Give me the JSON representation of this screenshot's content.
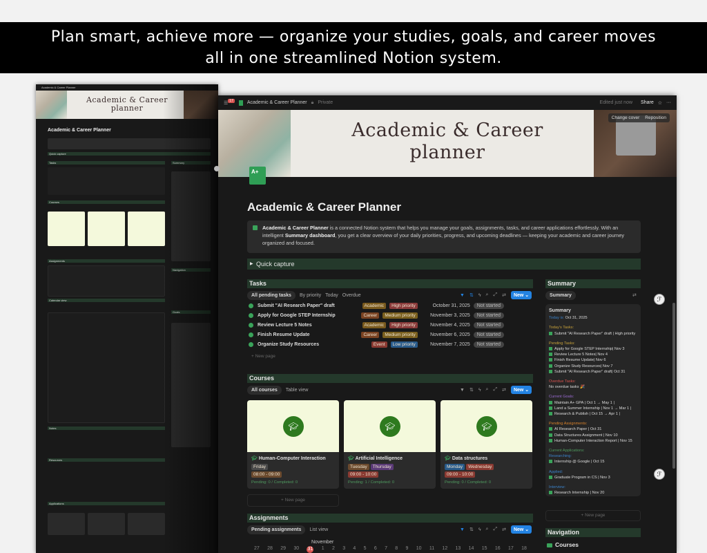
{
  "banner": {
    "line1": "Plan smart, achieve more — organize your studies, goals, and career moves",
    "line2": "all in one streamlined Notion system."
  },
  "topbar": {
    "badge": "17",
    "breadcrumb": "Academic & Career Planner",
    "privacy": "Private",
    "edited": "Edited just now",
    "share": "Share"
  },
  "cover": {
    "title_line1": "Academic & Career",
    "title_line2": "planner",
    "change_cover": "Change cover",
    "reposition": "Reposition"
  },
  "page": {
    "icon_text": "A+",
    "title": "Academic & Career Planner",
    "callout": {
      "bold1": "Academic & Career Planner",
      "text1": " is a connected Notion system that helps you manage your goals, assignments, tasks, and career applications effortlessly. With an intelligent ",
      "bold2": "Summary dashboard",
      "text2": ", you get a clear overview of your daily priorities, progress, and upcoming deadlines — keeping your academic and career journey organized and focused."
    },
    "quick_capture": "Quick capture"
  },
  "tasks": {
    "title": "Tasks",
    "views": [
      "All pending tasks",
      "By priority",
      "Today",
      "Overdue"
    ],
    "new": "New",
    "new_page": "New page",
    "rows": [
      {
        "name": "Submit \"AI Research Paper\" draft",
        "category": "Academic",
        "priority": "High priority",
        "date": "October 31, 2025",
        "status": "Not started"
      },
      {
        "name": "Apply for Google STEP Internship",
        "category": "Career",
        "priority": "Medium priority",
        "date": "November 3, 2025",
        "status": "Not started"
      },
      {
        "name": "Review Lecture 5 Notes",
        "category": "Academic",
        "priority": "High priority",
        "date": "November 4, 2025",
        "status": "Not started"
      },
      {
        "name": "Finish Resume Update",
        "category": "Career",
        "priority": "Medium priority",
        "date": "November 6, 2025",
        "status": "Not started"
      },
      {
        "name": "Organize Study Resources",
        "category": "Event",
        "priority": "Low priority",
        "date": "November 7, 2025",
        "status": "Not started"
      }
    ]
  },
  "colors": {
    "Academic": "#7a5a1e",
    "Career": "#7a4322",
    "Event": "#8a3a32",
    "High priority": "#8a3a3a",
    "Medium priority": "#7a5f1e",
    "Low priority": "#285a8a",
    "accent": "#2383e2",
    "section": "#24392b"
  },
  "courses": {
    "title": "Courses",
    "views": [
      "All courses",
      "Table view"
    ],
    "new": "New",
    "new_page": "New page",
    "cards": [
      {
        "name": "Human-Computer Interaction",
        "days": [
          "Friday"
        ],
        "time": "08:00 - 09:00",
        "pending": "Pending: 0",
        "completed": "Completed: 0"
      },
      {
        "name": "Artificial Intelligence",
        "days": [
          "Tuesday",
          "Thursday"
        ],
        "time": "09:00 - 10:00",
        "pending": "Pending: 1",
        "completed": "Completed: 0"
      },
      {
        "name": "Data structures",
        "days": [
          "Monday",
          "Wednesday"
        ],
        "time": "09:00 - 10:00",
        "pending": "Pending: 0",
        "completed": "Completed: 0"
      }
    ]
  },
  "assignments": {
    "title": "Assignments",
    "views": [
      "Pending assignments",
      "List view"
    ],
    "new": "New",
    "month": "November",
    "days": [
      "27",
      "28",
      "29",
      "30",
      "31",
      "1",
      "2",
      "3",
      "4",
      "5",
      "6",
      "7",
      "8",
      "9",
      "10",
      "11",
      "12",
      "13",
      "14",
      "15",
      "16",
      "17",
      "18"
    ]
  },
  "summary": {
    "title": "Summary",
    "view": "Summary",
    "heading": "Summary",
    "today_label": "Today is:",
    "today": "Oct 31, 2025",
    "todays_tasks_label": "Today's Tasks:",
    "todays_tasks": [
      "Submit \"AI Research Paper\" draft | High priority"
    ],
    "pending_tasks_label": "Pending Tasks:",
    "pending_tasks": [
      "Apply for Google STEP Internship| Nov 3",
      "Review Lecture 5 Notes| Nov 4",
      "Finish Resume Update| Nov 6",
      "Organize Study Resources| Nov 7",
      "Submit \"AI Research Paper\" draft| Oct 31"
    ],
    "overdue_label": "Overdue Tasks:",
    "overdue": "No overdue tasks 🎉",
    "goals_label": "Current Goals:",
    "goals": [
      "Maintain A+ GPA | Oct 1 → May 1 |",
      "Land a Summer Internship | Nov 1 → Mar 1 |",
      "Research & Publish | Oct 15 → Apr 1 |"
    ],
    "assign_label": "Pending Assignments:",
    "assign": [
      "AI Research Paper | Oct 31",
      "Data Structures Assignment | Nov 10",
      "Human-Computer Interaction Report | Nov 15"
    ],
    "apps_label": "Current Applications:",
    "researching": "Researching:",
    "researching_items": [
      "Internship @ Google | Oct 15"
    ],
    "applied": "Applied:",
    "applied_items": [
      "Graduate Program in CS | Nov 3"
    ],
    "interview": "Interview:",
    "interview_items": [
      "Research Internship | Nov 20"
    ],
    "new_page": "New page"
  },
  "navigation": {
    "title": "Navigation",
    "first": "Courses"
  },
  "mini": {
    "sections": [
      "Tasks",
      "Summary",
      "Courses",
      "Assignments",
      "Navigation",
      "Calendar view",
      "Goals",
      "Notes",
      "Resources",
      "Applications"
    ]
  }
}
